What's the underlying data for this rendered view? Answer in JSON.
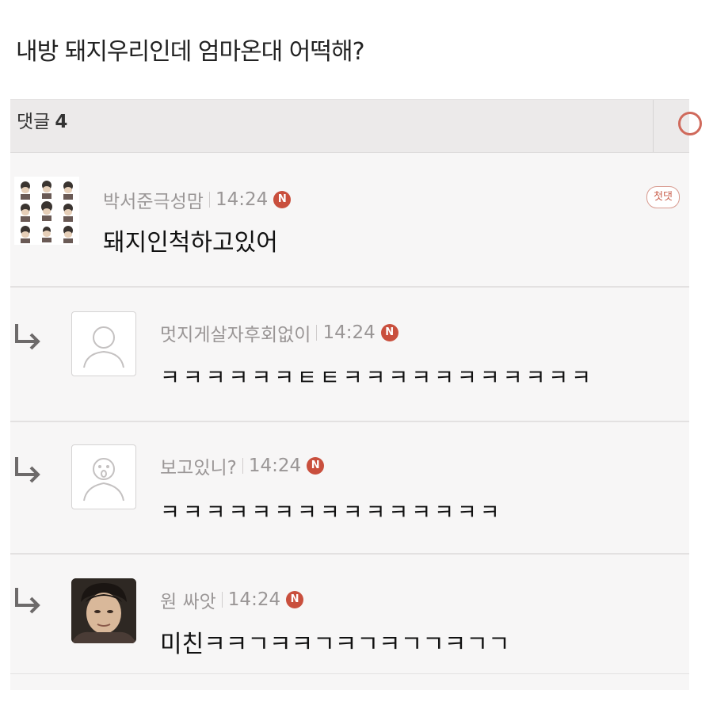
{
  "post": {
    "title": "내방 돼지우리인데 엄마온대 어떡해?"
  },
  "comments_header": {
    "label": "댓글",
    "count": "4"
  },
  "comments": [
    {
      "author": "박서준극성맘",
      "time": "14:24",
      "new_badge": "N",
      "text": "돼지인척하고있어",
      "tag": "첫댓",
      "avatar": "character-grid-avatar"
    },
    {
      "author": "멋지게살자후회없이",
      "time": "14:24",
      "new_badge": "N",
      "text": "ㅋㅋㅋㅋㅋㅋㅌㅌㅋㅋㅋㅋㅋㅋㅋㅋㅋㅋㅋ",
      "avatar": "default-user-avatar",
      "is_reply": true
    },
    {
      "author": "보고있니?",
      "time": "14:24",
      "new_badge": "N",
      "text": "ㅋㅋㅋㅋㅋㅋㅋㅋㅋㅋㅋㅋㅋㅋㅋ",
      "avatar": "default-user-avatar-shocked",
      "is_reply": true
    },
    {
      "author": "원 싸앗",
      "time": "14:24",
      "new_badge": "N",
      "text": "미친ㅋㅋㄱㅋㅋㄱㅋㄱㅋㄱㄱㅋㄱㄱ",
      "avatar": "photo-avatar",
      "is_reply": true
    }
  ]
}
